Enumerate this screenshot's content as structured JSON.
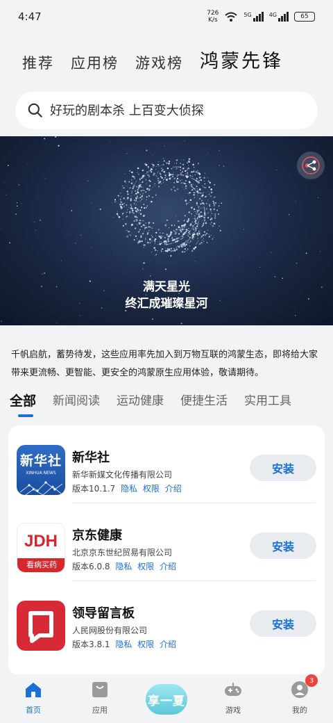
{
  "status_bar": {
    "time": "4:47",
    "net_speed_value": "726",
    "net_speed_unit": "K/s",
    "sig1_label": "5G",
    "sig2_label": "4G",
    "battery": "65"
  },
  "top_tabs": [
    "推荐",
    "应用榜",
    "游戏榜",
    "鸿蒙先锋"
  ],
  "search": {
    "placeholder": "好玩的剧本杀 上百变大侦探"
  },
  "banner": {
    "line1": "满天星光",
    "line2": "终汇成璀璨星河"
  },
  "description": "千帆启航，蓄势待发，这些应用率先加入到万物互联的鸿蒙生态，即将给大家带来更流畅、更智能、更安全的鸿蒙原生应用体验，敬请期待。",
  "categories": [
    "全部",
    "新闻阅读",
    "运动健康",
    "便捷生活",
    "实用工具"
  ],
  "apps": [
    {
      "name": "新华社",
      "company": "新华新媒文化传播有限公司",
      "version": "版本10.1.7",
      "links": [
        "隐私",
        "权限",
        "介绍"
      ],
      "button": "安装",
      "logo_text": "新华社",
      "logo_sub": "XINHUA NEWS"
    },
    {
      "name": "京东健康",
      "company": "北京京东世纪贸易有限公司",
      "version": "版本6.0.8",
      "links": [
        "隐私",
        "权限",
        "介绍"
      ],
      "button": "安装",
      "logo_text": "JDH",
      "logo_sub": "看病买药"
    },
    {
      "name": "领导留言板",
      "company": "人民网股份有限公司",
      "version": "版本3.8.1",
      "links": [
        "隐私",
        "权限",
        "介绍"
      ],
      "button": "安装"
    }
  ],
  "bottom_nav": {
    "home": "首页",
    "apps": "应用",
    "center": "享一夏",
    "games": "游戏",
    "mine": "我的",
    "mine_badge": "3"
  },
  "colors": {
    "accent": "#1a6fd8",
    "badge": "#e8453c"
  }
}
